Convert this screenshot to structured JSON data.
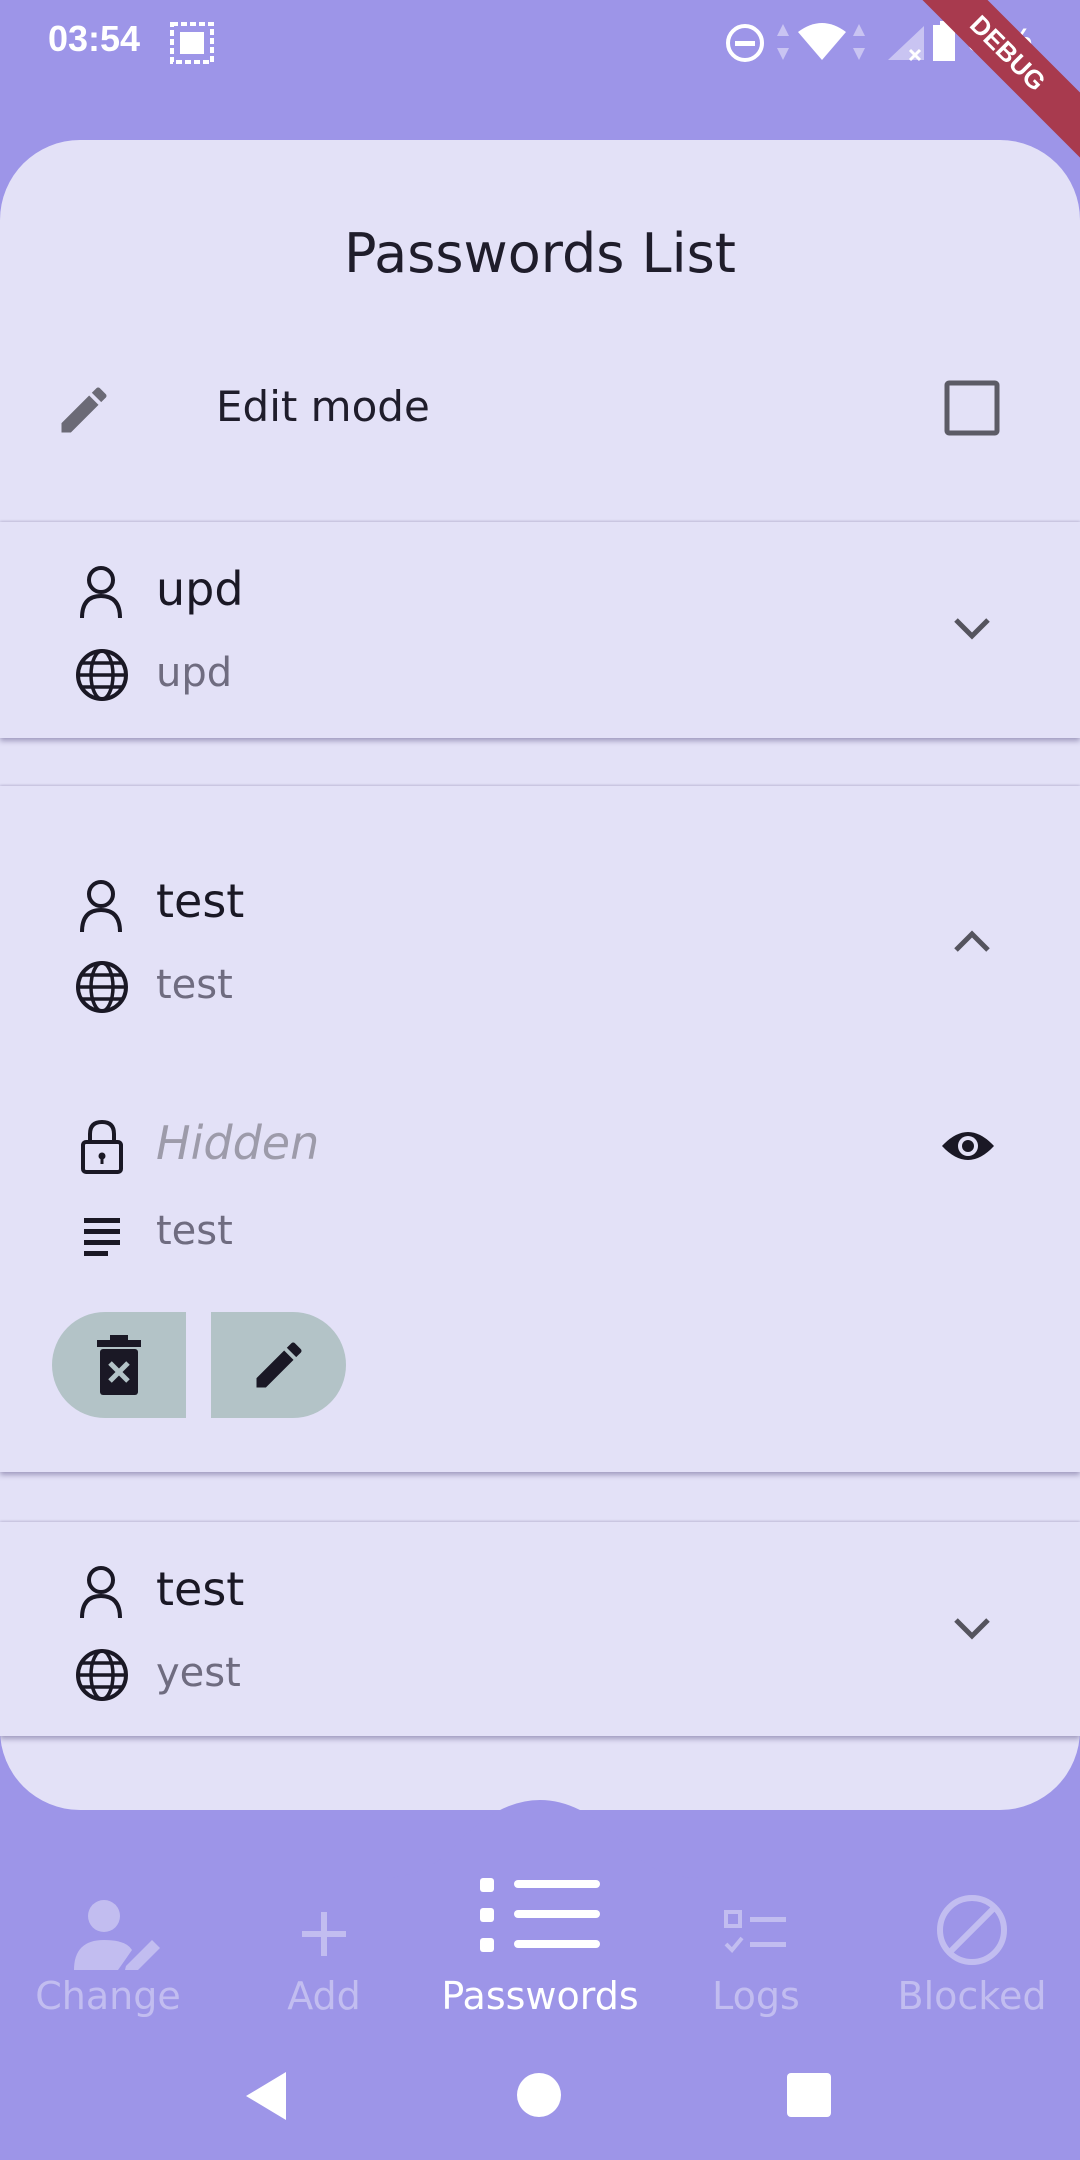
{
  "status_bar": {
    "time": "03:54",
    "battery_percent": "84%",
    "debug_banner": "DEBUG"
  },
  "page": {
    "title": "Passwords List",
    "edit_mode_label": "Edit mode",
    "edit_mode_checked": false
  },
  "entries": [
    {
      "username": "upd",
      "site": "upd",
      "expanded": false
    },
    {
      "username": "test",
      "site": "test",
      "expanded": true,
      "password_placeholder": "Hidden",
      "note": "test"
    },
    {
      "username": "test",
      "site": "yest",
      "expanded": false
    }
  ],
  "bottom_nav": {
    "items": [
      {
        "label": "Change",
        "icon": "person-edit-icon",
        "active": false
      },
      {
        "label": "Add",
        "icon": "plus-icon",
        "active": false
      },
      {
        "label": "Passwords",
        "icon": "list-icon",
        "active": true
      },
      {
        "label": "Logs",
        "icon": "checklist-icon",
        "active": false
      },
      {
        "label": "Blocked",
        "icon": "block-icon",
        "active": false
      }
    ]
  },
  "colors": {
    "background": "#9d95e8",
    "surface": "#e3e1f7",
    "action_button": "#b3c3c7",
    "debug_ribbon": "#a83a4e"
  }
}
